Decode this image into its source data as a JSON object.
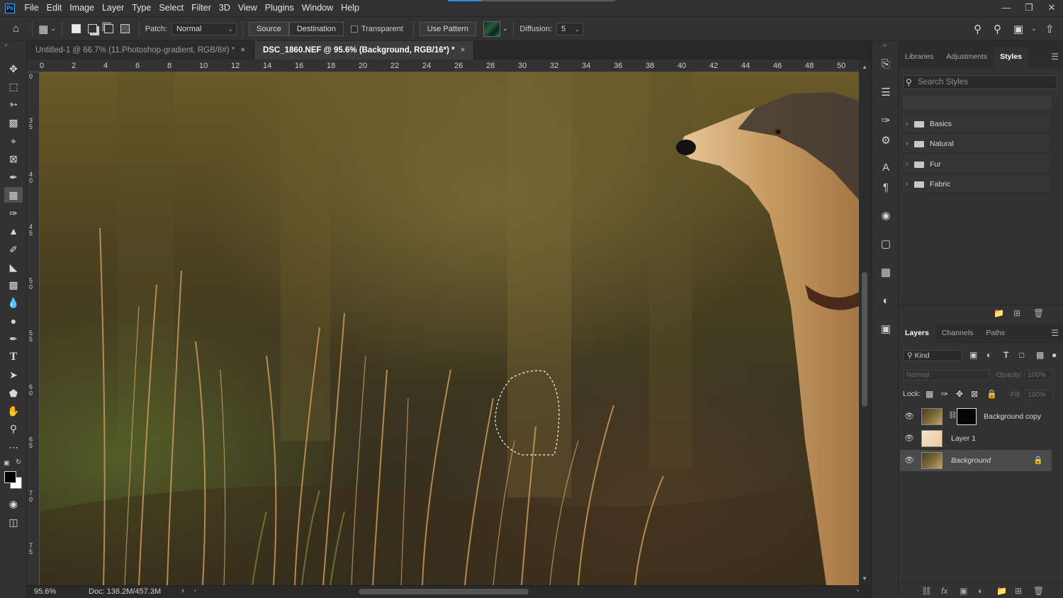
{
  "app": {
    "logo": "Ps",
    "menu": [
      "File",
      "Edit",
      "Image",
      "Layer",
      "Type",
      "Select",
      "Filter",
      "3D",
      "View",
      "Plugins",
      "Window",
      "Help"
    ]
  },
  "options_bar": {
    "patch_label": "Patch:",
    "patch_mode": "Normal",
    "source_label": "Source",
    "destination_label": "Destination",
    "transparent_label": "Transparent",
    "transparent_checked": false,
    "use_pattern_label": "Use Pattern",
    "diffusion_label": "Diffusion:",
    "diffusion_value": "5"
  },
  "documents": {
    "tabs": [
      {
        "title": "Untitled-1 @ 66.7% (11.Photoshop-gradient, RGB/8#) *",
        "active": false
      },
      {
        "title": "DSC_1860.NEF @ 95.6% (Background, RGB/16*) *",
        "active": true
      }
    ],
    "close_glyph": "×"
  },
  "rulers": {
    "top_labels": [
      "0",
      "2",
      "4",
      "6",
      "8",
      "10",
      "12",
      "14",
      "16",
      "18",
      "20",
      "22",
      "24",
      "26",
      "28",
      "30",
      "32",
      "34",
      "36",
      "38",
      "40",
      "42",
      "44",
      "46",
      "48",
      "50"
    ],
    "left_labels": [
      "0",
      "35",
      "40",
      "45",
      "50",
      "55",
      "60",
      "65",
      "70",
      "75"
    ]
  },
  "status": {
    "zoom": "95.6%",
    "doc_size": "Doc: 138.2M/457.3M",
    "chevron": "›"
  },
  "styles_panel": {
    "tabs": [
      "Libraries",
      "Adjustments",
      "Styles"
    ],
    "active_tab": "Styles",
    "search_placeholder": "Search Styles",
    "folders": [
      "Basics",
      "Natural",
      "Fur",
      "Fabric"
    ]
  },
  "layers_panel": {
    "tabs": [
      "Layers",
      "Channels",
      "Paths"
    ],
    "active_tab": "Layers",
    "filter_kind": "Kind",
    "blend_mode": "Normal",
    "opacity_label": "Opacity:",
    "opacity_value": "100%",
    "lock_label": "Lock:",
    "fill_label": "Fill:",
    "fill_value": "100%",
    "layers": [
      {
        "name": "Background copy",
        "has_mask": true,
        "visible": true,
        "selected": false,
        "locked": false
      },
      {
        "name": "Layer 1",
        "has_mask": false,
        "visible": true,
        "selected": false,
        "locked": false
      },
      {
        "name": "Background",
        "has_mask": false,
        "visible": true,
        "selected": true,
        "locked": true
      }
    ]
  },
  "colors": {
    "accent": "#2d8ceb",
    "panel_bg": "#323232",
    "foreground": "#000000",
    "background": "#ffffff"
  },
  "icons": {
    "tools": [
      "move-icon",
      "marquee-icon",
      "lasso-icon",
      "object-select-icon",
      "crop-icon",
      "frame-icon",
      "eyedropper-icon",
      "patch-icon",
      "brush-icon",
      "stamp-icon",
      "history-brush-icon",
      "eraser-icon",
      "gradient-icon",
      "blur-icon",
      "dodge-icon",
      "pen-icon",
      "type-icon",
      "path-select-icon",
      "shape-icon",
      "hand-icon",
      "zoom-icon",
      "more-icon"
    ]
  }
}
